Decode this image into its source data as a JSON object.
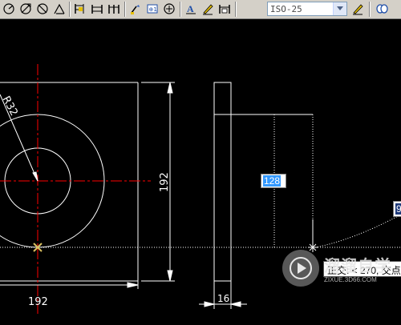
{
  "toolbar": {
    "dimension_style": {
      "value": "ISO-25"
    },
    "icons": [
      "dim-radius-icon",
      "dim-diameter-icon",
      "dim-angular-icon",
      "quick-dim-icon",
      "dim-baseline-icon",
      "dim-continue-icon",
      "dim-leader-icon",
      "tolerance-icon",
      "center-mark-icon",
      "dimedit-icon",
      "dimtedit-icon",
      "dim-update-icon",
      "dim-style-icon",
      "extra-icon"
    ]
  },
  "drawing": {
    "dimensions": {
      "height_front": "192",
      "width_front": "192",
      "radius": "R32",
      "width_side": "16"
    }
  },
  "dynamic_input": {
    "primary_value": "128",
    "secondary_value": "9"
  },
  "tooltip": {
    "text": "正交: < 270, 交点"
  },
  "watermark": {
    "title": "溜溜自学",
    "url": "ZIXUE.3D66.COM"
  },
  "colors": {
    "background": "#000000",
    "geometry": "#ffffff",
    "centerline": "#ff0000",
    "marker": "#d8c060",
    "toolbar": "#d4d0c8"
  }
}
